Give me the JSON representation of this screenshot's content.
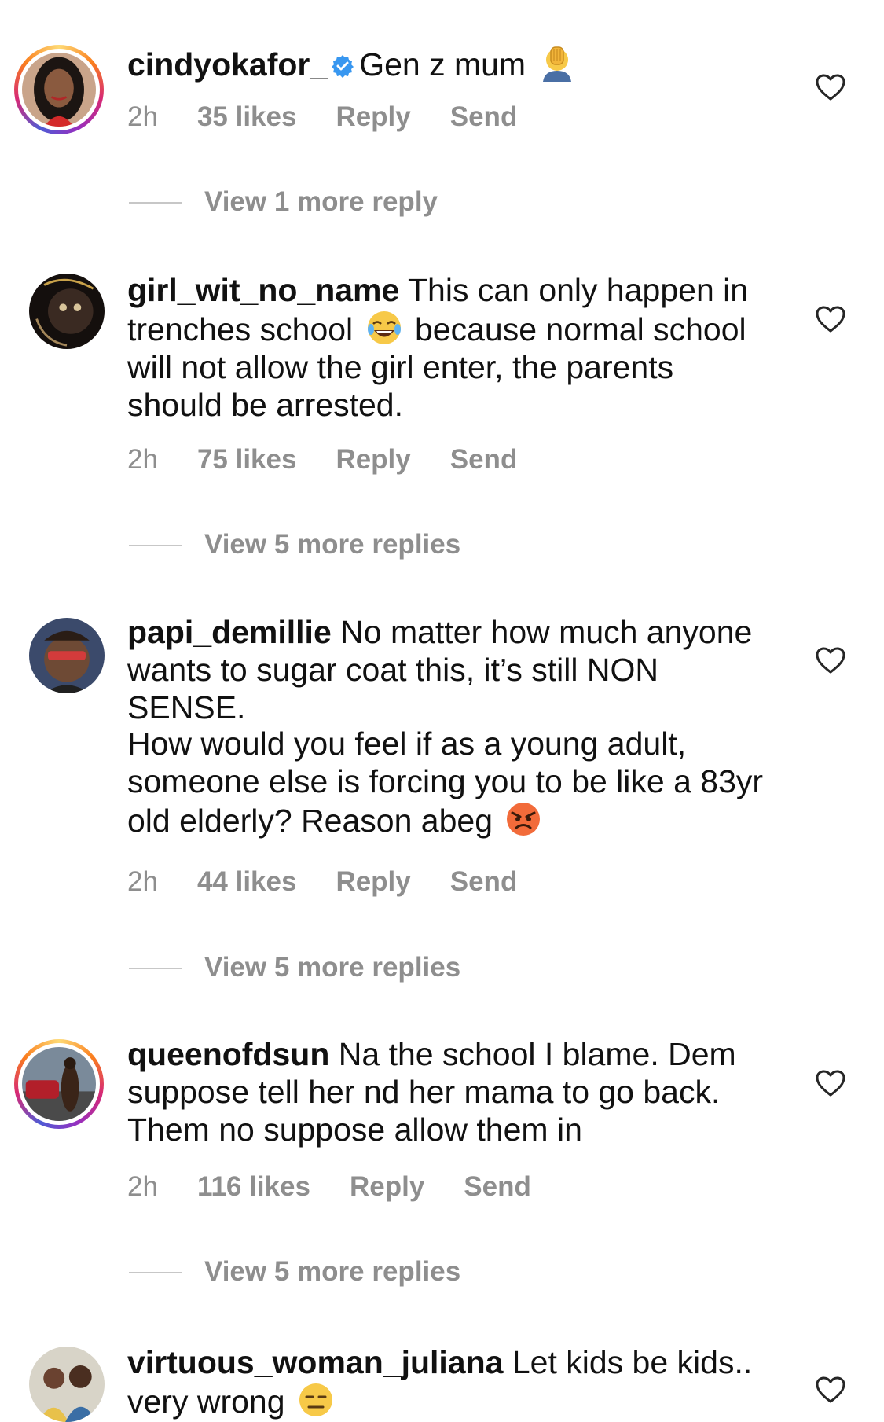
{
  "comments": [
    {
      "username": "cindyokafor_",
      "verified": true,
      "text": "Gen z mum",
      "emoji": "face-palm-emoji",
      "time": "2h",
      "likes": "35 likes",
      "reply": "Reply",
      "send": "Send",
      "view_more": "View 1 more reply"
    },
    {
      "username": "girl_wit_no_name",
      "text_a": "This can only happen in trenches school",
      "emoji": "joy-emoji",
      "text_b": "because normal school will not allow the girl enter, the parents should be arrested.",
      "time": "2h",
      "likes": "75 likes",
      "reply": "Reply",
      "send": "Send",
      "view_more": "View 5 more replies"
    },
    {
      "username": "papi_demillie",
      "text_a": "No matter how much anyone wants to sugar coat this, it’s still NON SENSE.",
      "text_b": "How would you feel if as a young adult, someone else is forcing you to be like a 83yr old elderly? Reason abeg",
      "emoji": "angry-emoji",
      "time": "2h",
      "likes": "44 likes",
      "reply": "Reply",
      "send": "Send",
      "view_more": "View 5 more replies"
    },
    {
      "username": "queenofdsun",
      "text": "Na the school I blame. Dem suppose tell her nd her mama to go back. Them no suppose allow them in",
      "time": "2h",
      "likes": "116 likes",
      "reply": "Reply",
      "send": "Send",
      "view_more": "View 5 more replies"
    },
    {
      "username": "virtuous_woman_juliana",
      "text": "Let kids be kids.. very wrong",
      "emoji": "expressionless-emoji"
    }
  ],
  "colors": {
    "primary_text": "#111111",
    "secondary_text": "#8e8e8e",
    "verified_blue": "#3897f0",
    "divider": "#c7c7c7"
  }
}
